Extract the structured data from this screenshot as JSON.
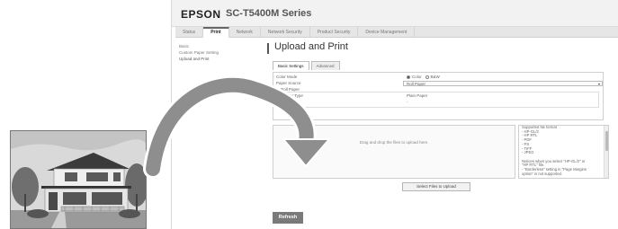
{
  "header": {
    "brand": "EPSON",
    "model": "SC-T5400M Series"
  },
  "tabs": [
    {
      "label": "Status"
    },
    {
      "label": "Print",
      "active": true
    },
    {
      "label": "Network"
    },
    {
      "label": "Network Security"
    },
    {
      "label": "Product Security"
    },
    {
      "label": "Device Management"
    }
  ],
  "sidebar": {
    "items": [
      {
        "label": "Basic"
      },
      {
        "label": "Custom Paper Setting"
      },
      {
        "label": "Upload and Print",
        "current": true
      }
    ]
  },
  "main": {
    "title": "Upload and Print",
    "subtabs": [
      {
        "label": "Basic Settings",
        "active": true
      },
      {
        "label": "Advanced"
      }
    ],
    "settings": {
      "color_mode_label": "Color Mode",
      "color_option": "Color",
      "bw_option": "B&W",
      "paper_source_label": "Paper Source",
      "paper_source_value": "Roll Paper",
      "roll_paper_label": "Roll Paper",
      "paper_type_label": "Paper Type",
      "paper_type_value": "Plain Paper",
      "width_label": "Width",
      "width_value": "-"
    },
    "dropzone_text": "Drag and drop the files to upload here.",
    "formats": [
      "Supported file format",
      "- HP-GL/2",
      "- HP RTL",
      "- PDF",
      "- PS",
      "- TIFF",
      "- JPEG",
      "",
      "Notices when you select \"HP-GL/2\" or",
      "\"HP RTL\" file.",
      "- \"Borderless\" setting in \"Page Margins",
      "option\" is not supported."
    ],
    "select_files_label": "Select Files to Upload",
    "refresh_label": "Refresh"
  }
}
